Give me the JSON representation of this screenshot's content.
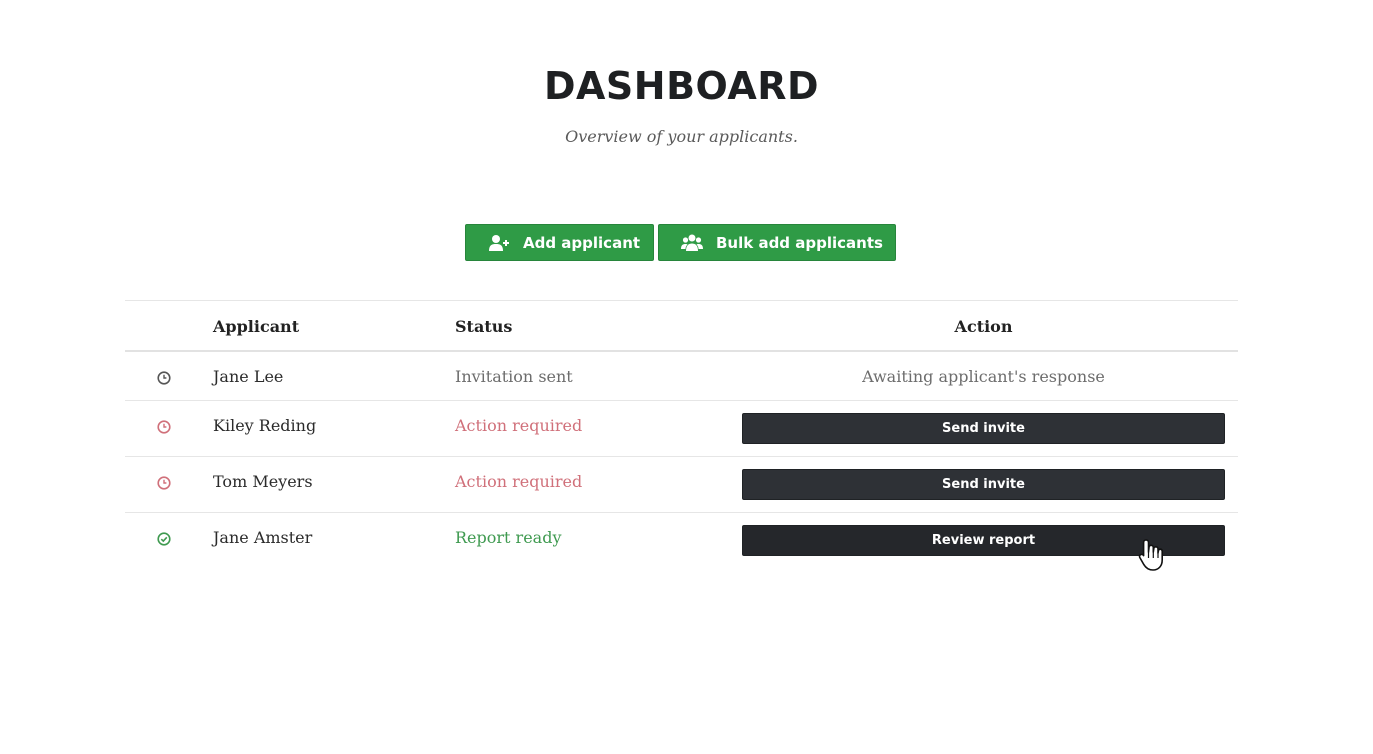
{
  "header": {
    "title": "DASHBOARD",
    "subtitle": "Overview of your applicants."
  },
  "toolbar": {
    "add_label": "Add applicant",
    "add_icon": "user-plus-icon",
    "bulk_label": "Bulk add applicants",
    "bulk_icon": "users-icon"
  },
  "table": {
    "headers": {
      "applicant": "Applicant",
      "status": "Status",
      "action": "Action"
    },
    "rows": [
      {
        "name": "Jane Lee",
        "status": "Invitation sent",
        "status_color": "#6d6d6d",
        "icon": "clock-icon",
        "action_text": "Awaiting applicant's response"
      },
      {
        "name": "Kiley Reding",
        "status": "Action required",
        "status_color": "#d0707a",
        "icon": "clock-icon",
        "action_label": "Send invite"
      },
      {
        "name": "Tom Meyers",
        "status": "Action required",
        "status_color": "#d0707a",
        "icon": "clock-icon",
        "action_label": "Send invite"
      },
      {
        "name": "Jane Amster",
        "status": "Report ready",
        "status_color": "#3f9a50",
        "icon": "check-circle-icon",
        "action_label": "Review report"
      }
    ]
  },
  "colors": {
    "primary_green": "#2f9b46",
    "dark_button": "#2e3136"
  }
}
